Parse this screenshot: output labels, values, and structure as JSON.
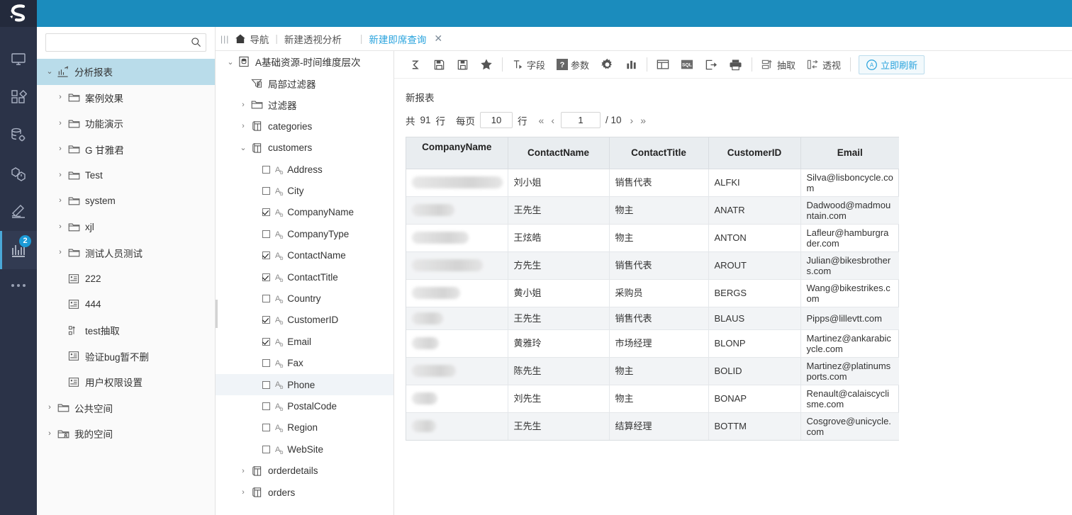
{
  "theme": {
    "brand_blue": "#1b8cbd",
    "rail_bg": "#2b3348",
    "select_blue": "#b9dcea",
    "link_blue": "#29a3dd"
  },
  "rail": {
    "logo_icon": "s-logo-icon",
    "items": [
      {
        "icon": "monitor-icon",
        "name": "rail-item-monitor",
        "badge": ""
      },
      {
        "icon": "blocks-icon",
        "name": "rail-item-blocks",
        "badge": ""
      },
      {
        "icon": "database-gear-icon",
        "name": "rail-item-data-source",
        "badge": ""
      },
      {
        "icon": "cube-icon",
        "name": "rail-item-cube",
        "badge": ""
      },
      {
        "icon": "hammer-icon",
        "name": "rail-item-tools",
        "badge": ""
      },
      {
        "icon": "bar-chart-icon",
        "name": "rail-item-analysis",
        "badge": "2"
      }
    ],
    "more_icon": "more-dots-icon"
  },
  "search": {
    "value": "",
    "placeholder": "",
    "icon": "search-icon"
  },
  "left_tree": [
    {
      "label": "分析报表",
      "icon": "analysis-report-icon",
      "arrow": "expanded",
      "indent": 0,
      "selected": true
    },
    {
      "label": "案例效果",
      "icon": "folder-icon",
      "arrow": "collapsed",
      "indent": 1,
      "selected": false
    },
    {
      "label": "功能演示",
      "icon": "folder-icon",
      "arrow": "collapsed",
      "indent": 1,
      "selected": false
    },
    {
      "label": "G 甘雅君",
      "icon": "folder-icon",
      "arrow": "collapsed",
      "indent": 1,
      "selected": false
    },
    {
      "label": "Test",
      "icon": "folder-icon",
      "arrow": "collapsed",
      "indent": 1,
      "selected": false
    },
    {
      "label": "system",
      "icon": "folder-icon",
      "arrow": "collapsed",
      "indent": 1,
      "selected": false
    },
    {
      "label": "xjl",
      "icon": "folder-icon",
      "arrow": "collapsed",
      "indent": 1,
      "selected": false
    },
    {
      "label": "测试人员测试",
      "icon": "folder-icon",
      "arrow": "collapsed",
      "indent": 1,
      "selected": false
    },
    {
      "label": "222",
      "icon": "report-icon",
      "arrow": "none",
      "indent": 1,
      "selected": false
    },
    {
      "label": "444",
      "icon": "report-icon",
      "arrow": "none",
      "indent": 1,
      "selected": false
    },
    {
      "label": "test抽取",
      "icon": "extract-icon",
      "arrow": "none",
      "indent": 1,
      "selected": false
    },
    {
      "label": "验证bug暂不删",
      "icon": "report-icon",
      "arrow": "none",
      "indent": 1,
      "selected": false
    },
    {
      "label": "用户权限设置",
      "icon": "report-icon",
      "arrow": "none",
      "indent": 1,
      "selected": false
    },
    {
      "label": "公共空间",
      "icon": "folder-icon",
      "arrow": "collapsed",
      "indent": 0,
      "selected": false
    },
    {
      "label": "我的空间",
      "icon": "folder-user-icon",
      "arrow": "collapsed",
      "indent": 0,
      "selected": false
    }
  ],
  "tabbar": {
    "grip_icon": "grip-icon",
    "home_icon": "home-icon",
    "home_label": "导航",
    "divider": "|",
    "crumb": "新建透视分析",
    "active_tab": "新建即席查询",
    "close_icon": "close-icon"
  },
  "mid_tree": [
    {
      "label": "A基础资源-时间维度层次",
      "icon": "dataset-icon",
      "arrow": "expanded",
      "indent": 0,
      "checkbox": "none",
      "highlight": false
    },
    {
      "label": "局部过滤器",
      "icon": "local-filter-icon",
      "arrow": "none",
      "indent": 1,
      "checkbox": "none",
      "highlight": false
    },
    {
      "label": "过滤器",
      "icon": "folder-icon",
      "arrow": "collapsed",
      "indent": 1,
      "checkbox": "none",
      "highlight": false
    },
    {
      "label": "categories",
      "icon": "table-icon",
      "arrow": "collapsed",
      "indent": 1,
      "checkbox": "none",
      "highlight": false
    },
    {
      "label": "customers",
      "icon": "table-icon",
      "arrow": "expanded",
      "indent": 1,
      "checkbox": "none",
      "highlight": false
    },
    {
      "label": "Address",
      "icon": "string-field-icon",
      "arrow": "none",
      "indent": 2,
      "checkbox": "off",
      "highlight": false
    },
    {
      "label": "City",
      "icon": "string-field-icon",
      "arrow": "none",
      "indent": 2,
      "checkbox": "off",
      "highlight": false
    },
    {
      "label": "CompanyName",
      "icon": "string-field-icon",
      "arrow": "none",
      "indent": 2,
      "checkbox": "on",
      "highlight": false
    },
    {
      "label": "CompanyType",
      "icon": "string-field-icon",
      "arrow": "none",
      "indent": 2,
      "checkbox": "off",
      "highlight": false
    },
    {
      "label": "ContactName",
      "icon": "string-field-icon",
      "arrow": "none",
      "indent": 2,
      "checkbox": "on",
      "highlight": false
    },
    {
      "label": "ContactTitle",
      "icon": "string-field-icon",
      "arrow": "none",
      "indent": 2,
      "checkbox": "on",
      "highlight": false
    },
    {
      "label": "Country",
      "icon": "string-field-icon",
      "arrow": "none",
      "indent": 2,
      "checkbox": "off",
      "highlight": false
    },
    {
      "label": "CustomerID",
      "icon": "string-field-icon",
      "arrow": "none",
      "indent": 2,
      "checkbox": "on",
      "highlight": false
    },
    {
      "label": "Email",
      "icon": "string-field-icon",
      "arrow": "none",
      "indent": 2,
      "checkbox": "on",
      "highlight": false
    },
    {
      "label": "Fax",
      "icon": "string-field-icon",
      "arrow": "none",
      "indent": 2,
      "checkbox": "off",
      "highlight": false
    },
    {
      "label": "Phone",
      "icon": "string-field-icon",
      "arrow": "none",
      "indent": 2,
      "checkbox": "off",
      "highlight": true
    },
    {
      "label": "PostalCode",
      "icon": "string-field-icon",
      "arrow": "none",
      "indent": 2,
      "checkbox": "off",
      "highlight": false
    },
    {
      "label": "Region",
      "icon": "string-field-icon",
      "arrow": "none",
      "indent": 2,
      "checkbox": "off",
      "highlight": false
    },
    {
      "label": "WebSite",
      "icon": "string-field-icon",
      "arrow": "none",
      "indent": 2,
      "checkbox": "off",
      "highlight": false
    },
    {
      "label": "orderdetails",
      "icon": "table-icon",
      "arrow": "collapsed",
      "indent": 1,
      "checkbox": "none",
      "highlight": false
    },
    {
      "label": "orders",
      "icon": "table-icon",
      "arrow": "collapsed",
      "indent": 1,
      "checkbox": "none",
      "highlight": false
    }
  ],
  "toolbar": [
    {
      "name": "undo-redo-button",
      "icon": "redo-icon",
      "label": ""
    },
    {
      "name": "save-button",
      "icon": "save-icon",
      "label": ""
    },
    {
      "name": "save-as-button",
      "icon": "save-as-icon",
      "label": ""
    },
    {
      "name": "favorite-button",
      "icon": "star-icon",
      "label": ""
    },
    {
      "name": "separator",
      "icon": "separator",
      "label": ""
    },
    {
      "name": "field-button",
      "icon": "field-icon",
      "label": "字段"
    },
    {
      "name": "parameter-button",
      "icon": "question-icon",
      "label": "参数"
    },
    {
      "name": "settings-button",
      "icon": "gear-icon",
      "label": ""
    },
    {
      "name": "chart-button",
      "icon": "chart-icon",
      "label": ""
    },
    {
      "name": "separator",
      "icon": "separator",
      "label": ""
    },
    {
      "name": "layout-button",
      "icon": "layout-icon",
      "label": ""
    },
    {
      "name": "sql-button",
      "icon": "sql-icon",
      "label": ""
    },
    {
      "name": "export-button",
      "icon": "export-icon",
      "label": ""
    },
    {
      "name": "print-button",
      "icon": "printer-icon",
      "label": ""
    },
    {
      "name": "separator",
      "icon": "separator",
      "label": ""
    },
    {
      "name": "extract-button",
      "icon": "extract-icon",
      "label": "抽取"
    },
    {
      "name": "pivot-button",
      "icon": "pivot-icon",
      "label": "透视"
    },
    {
      "name": "separator",
      "icon": "separator",
      "label": ""
    },
    {
      "name": "refresh-now-button",
      "icon": "auto-refresh-icon",
      "label": "立即刷新"
    }
  ],
  "report": {
    "title": "新报表",
    "pager": {
      "total_prefix": "共",
      "total_rows": "91",
      "total_suffix": "行",
      "per_page_label": "每页",
      "per_page_value": "10",
      "per_page_suffix": "行",
      "first_icon": "«",
      "prev_icon": "‹",
      "page_value": "1",
      "page_total": "/ 10",
      "next_icon": "›",
      "last_icon": "»"
    },
    "columns": [
      "CompanyName",
      "ContactName",
      "ContactTitle",
      "CustomerID",
      "Email"
    ],
    "rows": [
      {
        "CompanyName": "",
        "redact_w": 128,
        "ContactName": "刘小姐",
        "ContactTitle": "销售代表",
        "CustomerID": "ALFKI",
        "Email": "Silva@lisboncycle.com"
      },
      {
        "CompanyName": "",
        "redact_w": 60,
        "ContactName": "王先生",
        "ContactTitle": "物主",
        "CustomerID": "ANATR",
        "Email": "Dadwood@madmountain.com"
      },
      {
        "CompanyName": "",
        "redact_w": 80,
        "ContactName": "王炫皓",
        "ContactTitle": "物主",
        "CustomerID": "ANTON",
        "Email": "Lafleur@hamburgrader.com"
      },
      {
        "CompanyName": "",
        "redact_w": 100,
        "ContactName": "方先生",
        "ContactTitle": "销售代表",
        "CustomerID": "AROUT",
        "Email": "Julian@bikesbrothers.com"
      },
      {
        "CompanyName": "",
        "redact_w": 68,
        "ContactName": "黄小姐",
        "ContactTitle": "采购员",
        "CustomerID": "BERGS",
        "Email": "Wang@bikestrikes.com"
      },
      {
        "CompanyName": "",
        "redact_w": 44,
        "ContactName": "王先生",
        "ContactTitle": "销售代表",
        "CustomerID": "BLAUS",
        "Email": "Pipps@lillevtt.com"
      },
      {
        "CompanyName": "",
        "redact_w": 38,
        "ContactName": "黄雅玲",
        "ContactTitle": "市场经理",
        "CustomerID": "BLONP",
        "Email": "Martinez@ankarabicycle.com"
      },
      {
        "CompanyName": "",
        "redact_w": 62,
        "ContactName": "陈先生",
        "ContactTitle": "物主",
        "CustomerID": "BOLID",
        "Email": "Martinez@platinumsports.com"
      },
      {
        "CompanyName": "",
        "redact_w": 36,
        "ContactName": "刘先生",
        "ContactTitle": "物主",
        "CustomerID": "BONAP",
        "Email": "Renault@calaiscyclisme.com"
      },
      {
        "CompanyName": "",
        "redact_w": 34,
        "ContactName": "王先生",
        "ContactTitle": "结算经理",
        "CustomerID": "BOTTM",
        "Email": "Cosgrove@unicycle.com"
      }
    ]
  }
}
